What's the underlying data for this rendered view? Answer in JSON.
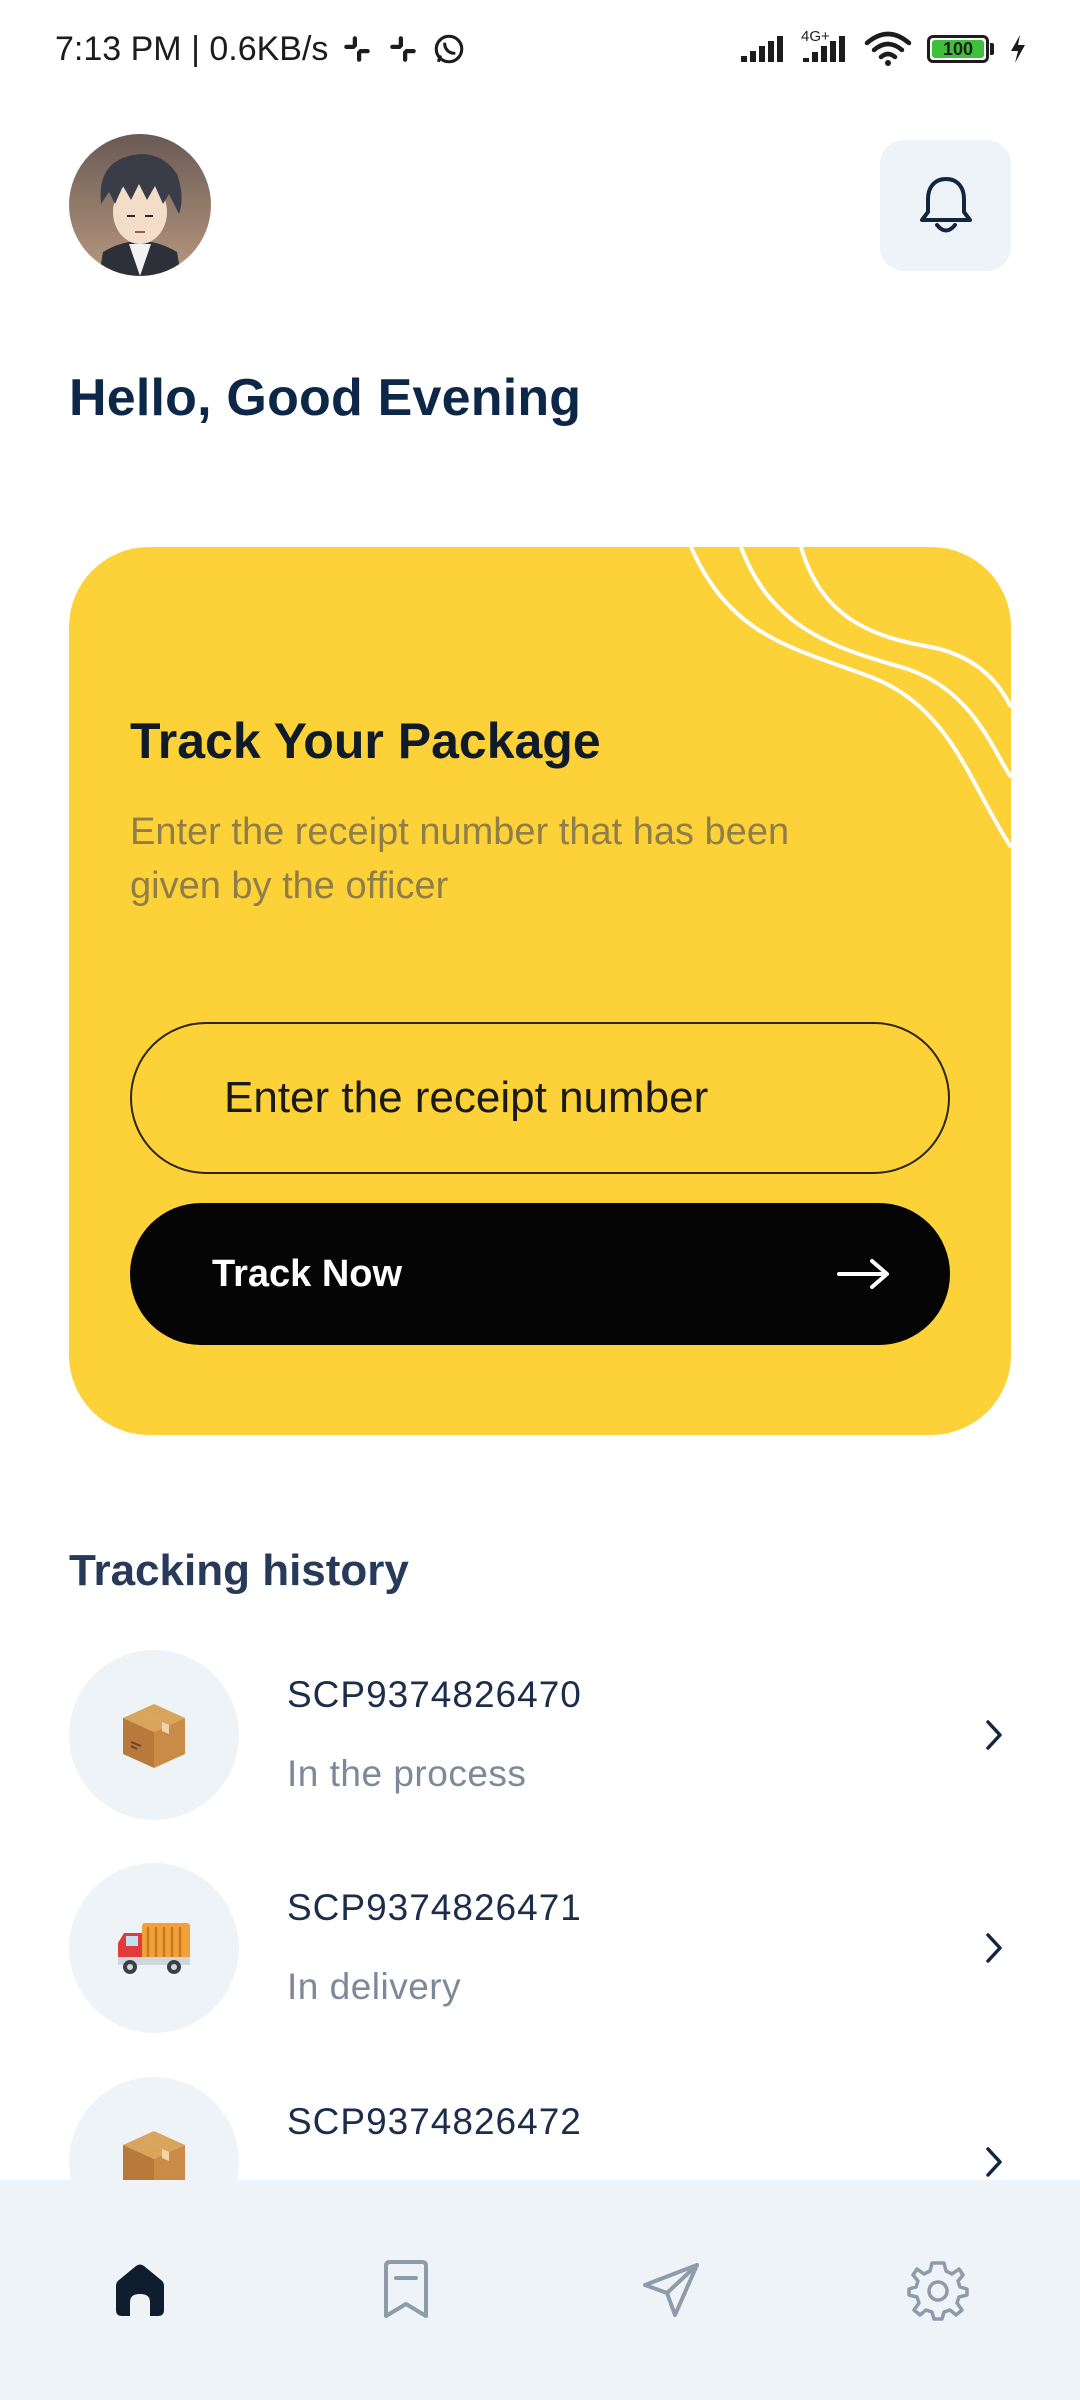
{
  "status_bar": {
    "time_speed": "7:13 PM | 0.6KB/s",
    "network_label": "4G+",
    "battery": "100"
  },
  "header": {
    "avatar_alt": "",
    "greeting": "Hello, Good Evening"
  },
  "track_card": {
    "title": "Track Your Package",
    "subtitle": "Enter the receipt number that has been given by the officer",
    "input_placeholder": "Enter the receipt number",
    "button_label": "Track Now",
    "background_color": "#fdd138"
  },
  "history": {
    "title": "Tracking history",
    "items": [
      {
        "code": "SCP9374826470",
        "status": "In the process",
        "icon": "package-icon"
      },
      {
        "code": "SCP9374826471",
        "status": "In delivery",
        "icon": "delivery-truck-icon"
      },
      {
        "code": "SCP9374826472",
        "status": "",
        "icon": "package-icon"
      }
    ]
  },
  "nav": {
    "items": [
      {
        "name": "home",
        "icon": "home-icon",
        "active": true
      },
      {
        "name": "saved",
        "icon": "bookmark-icon",
        "active": false
      },
      {
        "name": "send",
        "icon": "send-icon",
        "active": false
      },
      {
        "name": "settings",
        "icon": "gear-icon",
        "active": false
      }
    ]
  }
}
